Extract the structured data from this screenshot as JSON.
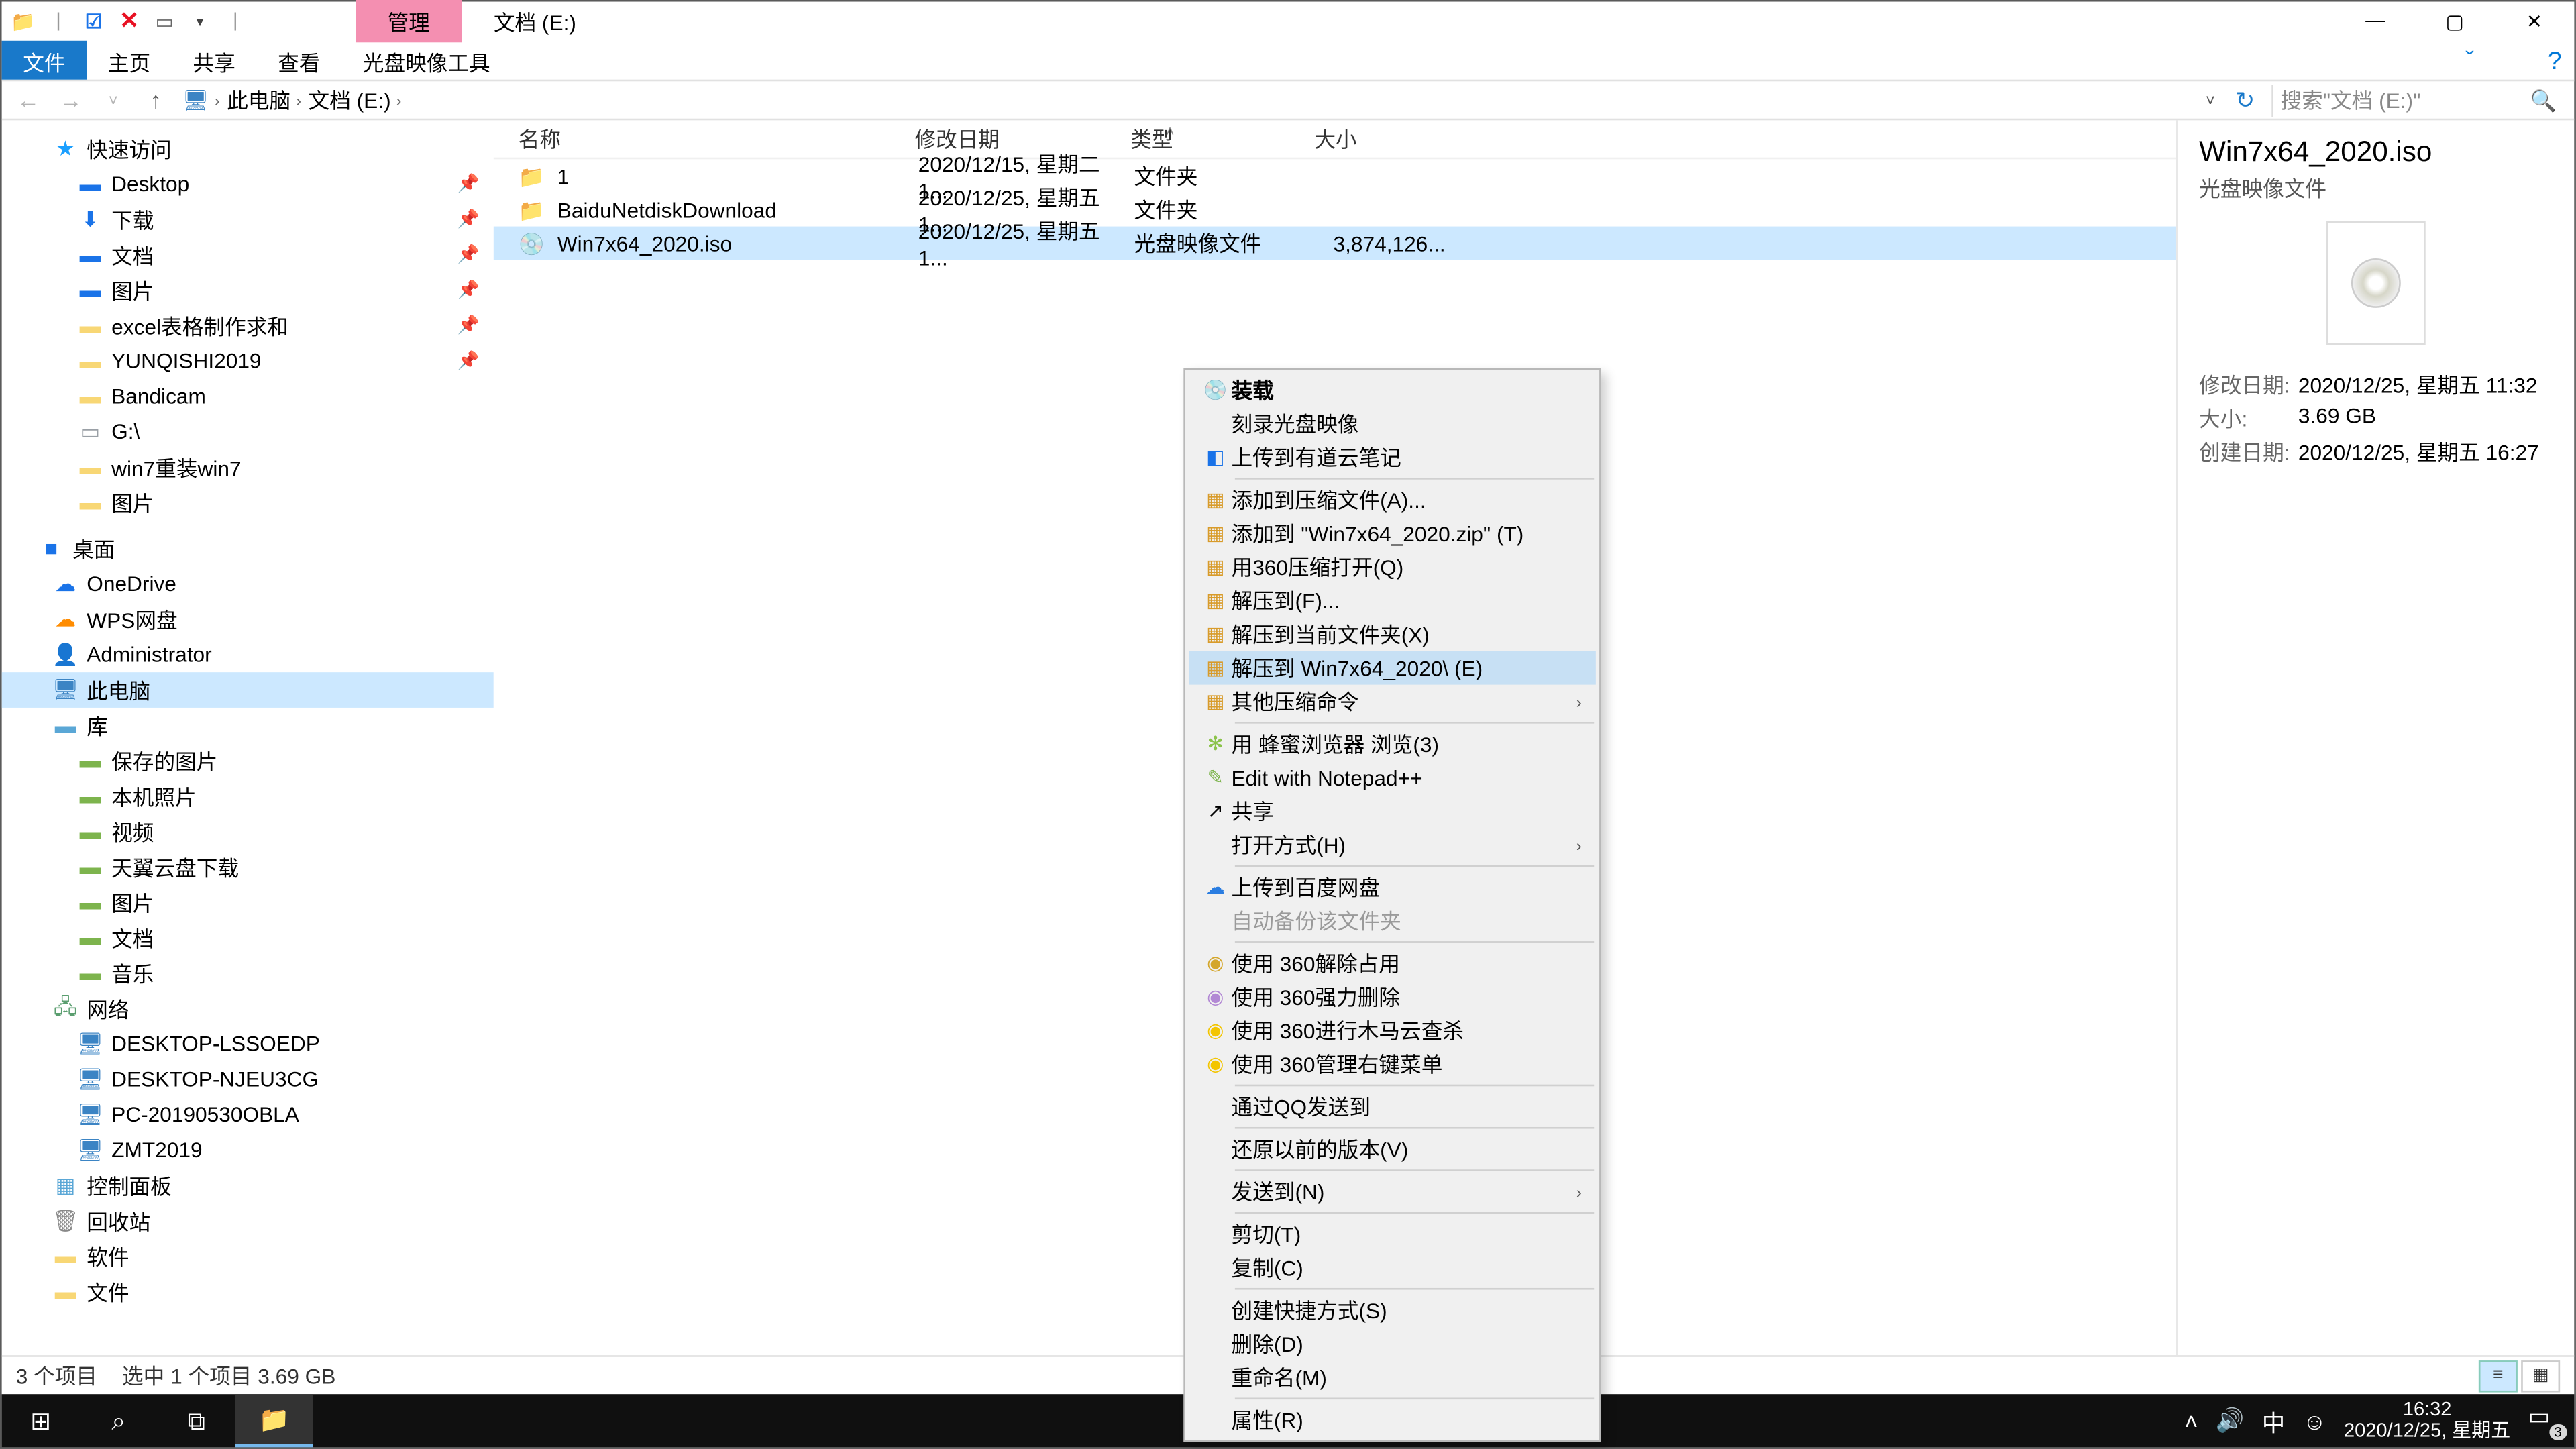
{
  "titlebar": {
    "context_tab": "管理",
    "title": "文档 (E:)"
  },
  "ribbon": {
    "file": "文件",
    "home": "主页",
    "share": "共享",
    "view": "查看",
    "iso_tools": "光盘映像工具"
  },
  "breadcrumb": {
    "pc": "此电脑",
    "drive": "文档 (E:)"
  },
  "search_placeholder": "搜索\"文档 (E:)\"",
  "sidebar": {
    "quick": "快速访问",
    "quick_items": [
      "Desktop",
      "下载",
      "文档",
      "图片",
      "excel表格制作求和",
      "YUNQISHI2019",
      "Bandicam",
      "G:\\",
      "win7重装win7",
      "图片"
    ],
    "desktop_root": "桌面",
    "desktop_items": [
      "OneDrive",
      "WPS网盘",
      "Administrator",
      "此电脑",
      "库"
    ],
    "lib_items": [
      "保存的图片",
      "本机照片",
      "视频",
      "天翼云盘下载",
      "图片",
      "文档",
      "音乐"
    ],
    "network": "网络",
    "net_items": [
      "DESKTOP-LSSOEDP",
      "DESKTOP-NJEU3CG",
      "PC-20190530OBLA",
      "ZMT2019"
    ],
    "extra": [
      "控制面板",
      "回收站",
      "软件",
      "文件"
    ]
  },
  "columns": {
    "name": "名称",
    "date": "修改日期",
    "type": "类型",
    "size": "大小"
  },
  "files": [
    {
      "name": "1",
      "date": "2020/12/15, 星期二 1...",
      "type": "文件夹",
      "size": ""
    },
    {
      "name": "BaiduNetdiskDownload",
      "date": "2020/12/25, 星期五 1...",
      "type": "文件夹",
      "size": ""
    },
    {
      "name": "Win7x64_2020.iso",
      "date": "2020/12/25, 星期五 1...",
      "type": "光盘映像文件",
      "size": "3,874,126..."
    }
  ],
  "context_menu": {
    "mount": "装载",
    "burn": "刻录光盘映像",
    "youdao": "上传到有道云笔记",
    "add_archive": "添加到压缩文件(A)...",
    "add_zip": "添加到 \"Win7x64_2020.zip\" (T)",
    "open_360zip": "用360压缩打开(Q)",
    "extract_to": "解压到(F)...",
    "extract_here": "解压到当前文件夹(X)",
    "extract_named": "解压到 Win7x64_2020\\ (E)",
    "other_zip": "其他压缩命令",
    "honey": "用 蜂蜜浏览器 浏览(3)",
    "notepadpp": "Edit with Notepad++",
    "share": "共享",
    "open_with": "打开方式(H)",
    "baidu_upload": "上传到百度网盘",
    "auto_backup": "自动备份该文件夹",
    "use360_unlock": "使用 360解除占用",
    "use360_force_del": "使用 360强力删除",
    "use360_trojan": "使用 360进行木马云查杀",
    "use360_menu": "使用 360管理右键菜单",
    "qq_send": "通过QQ发送到",
    "restore_prev": "还原以前的版本(V)",
    "send_to": "发送到(N)",
    "cut": "剪切(T)",
    "copy": "复制(C)",
    "shortcut": "创建快捷方式(S)",
    "delete": "删除(D)",
    "rename": "重命名(M)",
    "properties": "属性(R)"
  },
  "details": {
    "title": "Win7x64_2020.iso",
    "subtitle": "光盘映像文件",
    "modified_label": "修改日期:",
    "modified_value": "2020/12/25, 星期五 11:32",
    "size_label": "大小:",
    "size_value": "3.69 GB",
    "created_label": "创建日期:",
    "created_value": "2020/12/25, 星期五 16:27"
  },
  "status": {
    "count": "3 个项目",
    "selection": "选中 1 个项目  3.69 GB"
  },
  "taskbar": {
    "ime": "中",
    "time": "16:32",
    "date": "2020/12/25, 星期五",
    "badge": "3"
  }
}
